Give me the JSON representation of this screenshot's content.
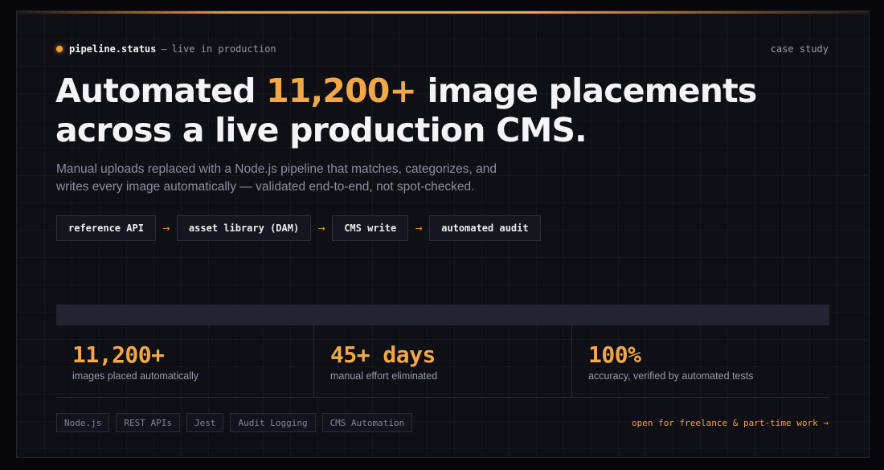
{
  "colors": {
    "accent": "#f0a848",
    "background": "#0f0f16",
    "text": "#f4f4f8",
    "muted": "#8e8e9e"
  },
  "status": {
    "icon": "status-dot-icon",
    "name": "pipeline.status",
    "separator": "—",
    "description": "live in production"
  },
  "case_study": "case study",
  "headline": {
    "prefix": "Automated ",
    "highlight": "11,200+",
    "suffix": " image placements across a live production CMS."
  },
  "subtitle": "Manual uploads replaced with a Node.js pipeline that matches, categorizes, and writes every image automatically — validated end-to-end, not spot-checked.",
  "pipeline": {
    "steps": [
      "reference API",
      "asset library (DAM)",
      "CMS write",
      "automated audit"
    ],
    "arrow": "→"
  },
  "stats": [
    {
      "value": "11,200+",
      "label": "images placed automatically"
    },
    {
      "value": "45+ days",
      "label": "manual effort eliminated"
    },
    {
      "value": "100%",
      "label": "accuracy, verified by automated tests"
    }
  ],
  "tags": [
    "Node.js",
    "REST APIs",
    "Jest",
    "Audit Logging",
    "CMS Automation"
  ],
  "freelance_link": "open for freelance & part-time work →"
}
